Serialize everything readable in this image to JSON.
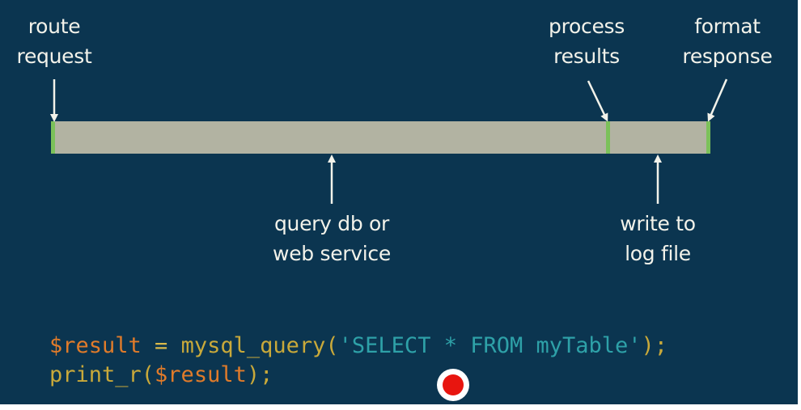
{
  "labels": {
    "route_request": [
      "route",
      "request"
    ],
    "process_results": [
      "process",
      "results"
    ],
    "format_response": [
      "format",
      "response"
    ],
    "query_db": [
      "query db or",
      "web service"
    ],
    "write_log": [
      "write to",
      "log file"
    ]
  },
  "code": {
    "line1": {
      "var": "$result",
      "eq": " = ",
      "fn": "mysql_query(",
      "str": "'SELECT * FROM myTable'",
      "end": ");"
    },
    "line2": {
      "fn": "print_r(",
      "var": "$result",
      "end": ");"
    }
  },
  "colors": {
    "background": "#0b3550",
    "bar": "#b2b3a2",
    "tick": "#7bc15a",
    "code_variable": "#e07b2a",
    "code_function": "#c9a93a",
    "code_string": "#2ea1a8",
    "record_dot": "#e8150f"
  }
}
